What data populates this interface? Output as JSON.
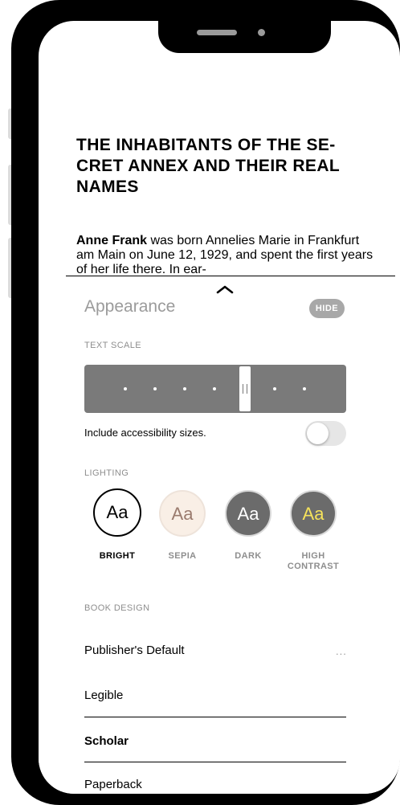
{
  "book": {
    "chapter_title": "THE INHABITANTS OF THE SE- CRET ANNEX AND THEIR REAL NAMES",
    "para_bold": "Anne Frank",
    "para_rest": " was born Annelies Marie in Frankfurt am Main on June 12, 1929, and spent the first years of her life there. In ear-"
  },
  "appearance": {
    "title": "Appearance",
    "hide_label": "HIDE",
    "text_scale_label": "TEXT SCALE",
    "text_scale_steps": 8,
    "text_scale_selected": 5,
    "accessibility_label": "Include accessibility sizes.",
    "accessibility_on": false,
    "lighting_label": "LIGHTING",
    "themes": [
      {
        "glyph": "Aa",
        "label": "BRIGHT",
        "selected": true,
        "bg": "#ffffff",
        "fg": "#000000"
      },
      {
        "glyph": "Aa",
        "label": "SEPIA",
        "selected": false,
        "bg": "#f9efe6",
        "fg": "#9a7b6e"
      },
      {
        "glyph": "Aa",
        "label": "DARK",
        "selected": false,
        "bg": "#6b6b6b",
        "fg": "#ffffff"
      },
      {
        "glyph": "Aa",
        "label": "HIGH CONTRAST",
        "selected": false,
        "bg": "#6b6b6b",
        "fg": "#f6e35b"
      }
    ],
    "book_design_label": "BOOK DESIGN",
    "designs": [
      {
        "label": "Publisher's Default",
        "more": "..."
      },
      {
        "label": "Legible"
      },
      {
        "label": "Scholar",
        "bold": true
      },
      {
        "label": "Paperback"
      }
    ]
  },
  "colors": {
    "frame": "#000000",
    "slider_bg": "#7a7a7a",
    "muted_text": "#9b9b9b",
    "hide_bg": "#a8a8a8"
  }
}
